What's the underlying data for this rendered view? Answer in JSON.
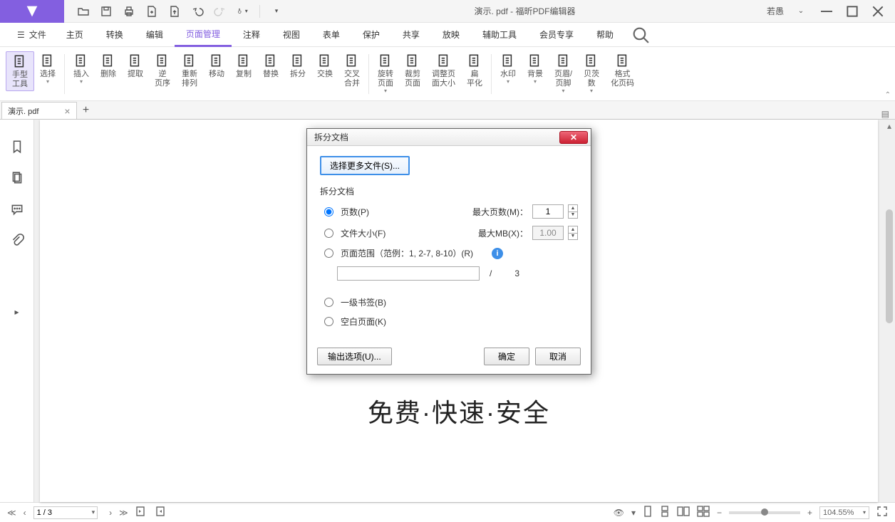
{
  "title_bar": {
    "document_title": "演示. pdf - 福昕PDF编辑器",
    "user_label": "若愚"
  },
  "menu": {
    "file": "文件",
    "tabs": [
      "主页",
      "转换",
      "编辑",
      "页面管理",
      "注释",
      "视图",
      "表单",
      "保护",
      "共享",
      "放映",
      "辅助工具",
      "会员专享",
      "帮助"
    ],
    "active_index": 3
  },
  "ribbon": [
    {
      "label": "手型\n工具",
      "caret": false,
      "active": true
    },
    {
      "label": "选择",
      "caret": true
    },
    {
      "sep": true
    },
    {
      "label": "插入",
      "caret": true
    },
    {
      "label": "删除",
      "caret": false
    },
    {
      "label": "提取",
      "caret": false
    },
    {
      "label": "逆\n页序",
      "caret": false
    },
    {
      "label": "重新\n排列",
      "caret": false
    },
    {
      "label": "移动",
      "caret": false
    },
    {
      "label": "复制",
      "caret": false
    },
    {
      "label": "替换",
      "caret": false
    },
    {
      "label": "拆分",
      "caret": false
    },
    {
      "label": "交换",
      "caret": false
    },
    {
      "label": "交叉\n合并",
      "caret": false
    },
    {
      "sep": true
    },
    {
      "label": "旋转\n页面",
      "caret": true
    },
    {
      "label": "裁剪\n页面",
      "caret": false
    },
    {
      "label": "调整页\n面大小",
      "caret": false
    },
    {
      "label": "扁\n平化",
      "caret": false
    },
    {
      "sep": true
    },
    {
      "label": "水印",
      "caret": true
    },
    {
      "label": "背景",
      "caret": true
    },
    {
      "label": "页眉/\n页脚",
      "caret": true
    },
    {
      "label": "贝茨\n数",
      "caret": true
    },
    {
      "label": "格式\n化页码",
      "caret": false
    }
  ],
  "document_tab": {
    "name": "演示. pdf"
  },
  "page_content": "免费·快速·安全",
  "dialog": {
    "title": "拆分文档",
    "select_more": "选择更多文件(S)...",
    "group_label": "拆分文档",
    "opt_pages": "页数(P)",
    "max_pages_label": "最大页数(M)：",
    "max_pages_value": "1",
    "opt_filesize": "文件大小(F)",
    "max_mb_label": "最大MB(X)：",
    "max_mb_value": "1.00",
    "opt_range": "页面范围（范例：1, 2-7, 8-10）(R)",
    "range_slash": "/",
    "range_total": "3",
    "opt_bookmark": "一级书签(B)",
    "opt_blank": "空白页面(K)",
    "output_options": "输出选项(U)...",
    "ok": "确定",
    "cancel": "取消"
  },
  "status": {
    "page_value": "1 / 3",
    "zoom_value": "104.55%"
  }
}
